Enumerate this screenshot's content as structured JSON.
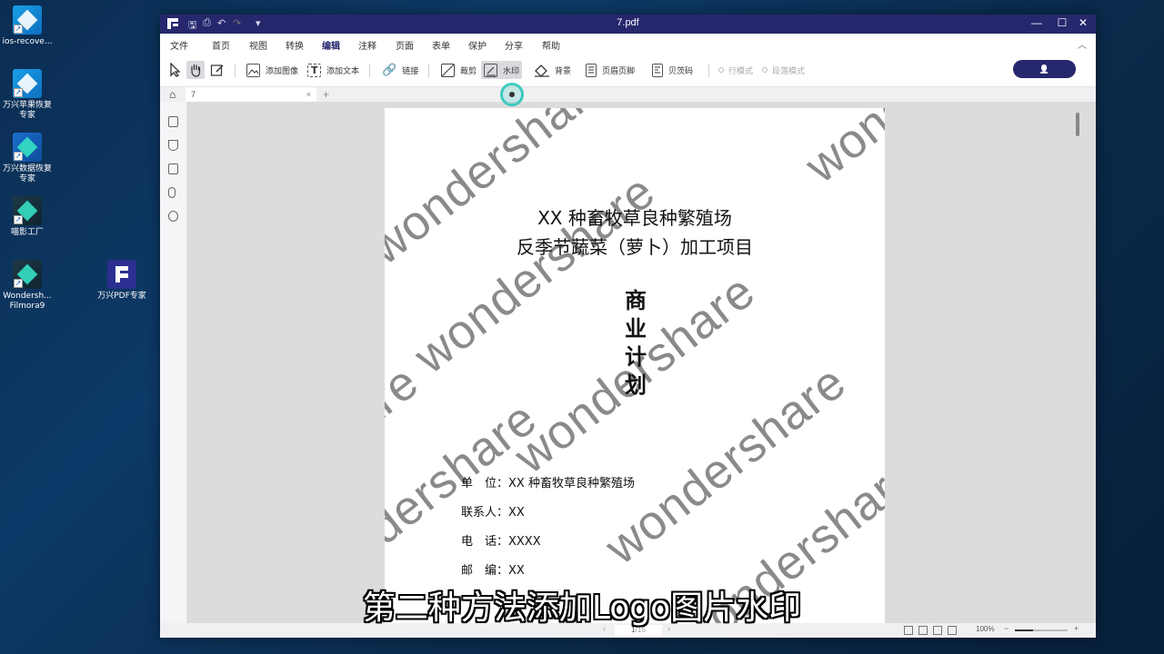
{
  "desktop": {
    "icons": [
      {
        "label": "ios-recove...",
        "icon": "wondershare-recovery-icon"
      },
      {
        "label": "万兴苹果恢复专家",
        "icon": "apple-recovery-icon"
      },
      {
        "label": "万兴数据恢复专家",
        "icon": "data-recovery-icon"
      },
      {
        "label": "喵影工厂",
        "icon": "filmora-icon"
      },
      {
        "label": "Wondersh... Filmora9",
        "icon": "filmora9-icon"
      },
      {
        "label": "万兴PDF专家",
        "icon": "pdf-expert-icon"
      }
    ]
  },
  "window": {
    "title": "7.pdf",
    "quick_access": [
      "save-icon",
      "print-icon",
      "undo-icon",
      "redo-icon",
      "dropdown-icon"
    ],
    "controls": {
      "minimize": "—",
      "maximize": "☐",
      "close": "✕"
    },
    "accent_color": "#26276d"
  },
  "menu": {
    "items": [
      "文件",
      "首页",
      "视图",
      "转换",
      "编辑",
      "注释",
      "页面",
      "表单",
      "保护",
      "分享",
      "帮助"
    ],
    "active": "编辑",
    "collapse": "︿"
  },
  "toolbar": {
    "add_image": "添加图像",
    "add_text": "添加文本",
    "link": "链接",
    "crop": "裁剪",
    "watermark": "水印",
    "background": "背景",
    "header_footer": "页眉页脚",
    "bates": "贝茨码",
    "line_mode": "行模式",
    "paragraph_mode": "段落模式",
    "user_glyph": "👤"
  },
  "tabs": {
    "doc_tab": "7",
    "close": "×",
    "add": "+",
    "home": "⌂"
  },
  "document": {
    "watermark_text": "wondershare",
    "title_line1": "XX 种畜牧草良种繁殖场",
    "title_line2": "反季节蔬菜（萝卜）加工项目",
    "vertical_title": [
      "商",
      "业",
      "计",
      "划"
    ],
    "info": {
      "unit": "单　位：XX 种畜牧草良种繁殖场",
      "contact": "联系人：XX",
      "phone": "电　话：XXXX",
      "postal": "邮　编：XX"
    }
  },
  "status": {
    "page_current": "1",
    "page_total": "/15",
    "prev": "‹",
    "next": "›",
    "zoom": "100%",
    "zoom_minus": "−",
    "zoom_plus": "+",
    "zoom_level": 0.35
  },
  "caption": "第二种方法添加Logo图片水印"
}
